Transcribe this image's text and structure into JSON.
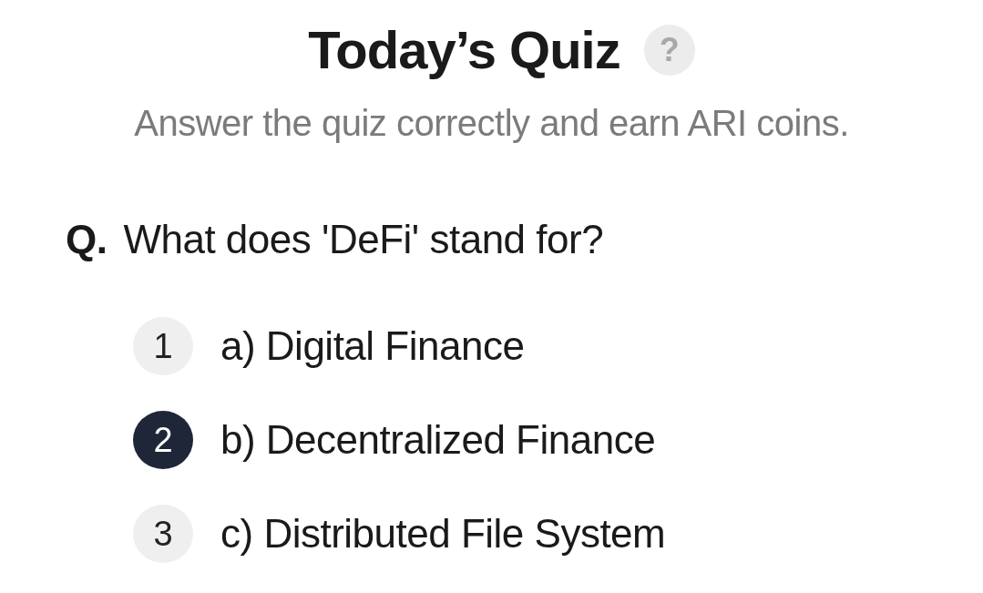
{
  "title": "Today’s Quiz",
  "help_icon": "?",
  "subtitle": "Answer the quiz correctly and earn ARI coins.",
  "question": {
    "prefix": "Q.",
    "text": "What does 'DeFi' stand for?"
  },
  "options": [
    {
      "number": "1",
      "label": "a) Digital Finance",
      "selected": false
    },
    {
      "number": "2",
      "label": "b) Decentralized Finance",
      "selected": true
    },
    {
      "number": "3",
      "label": "c) Distributed File System",
      "selected": false
    }
  ]
}
